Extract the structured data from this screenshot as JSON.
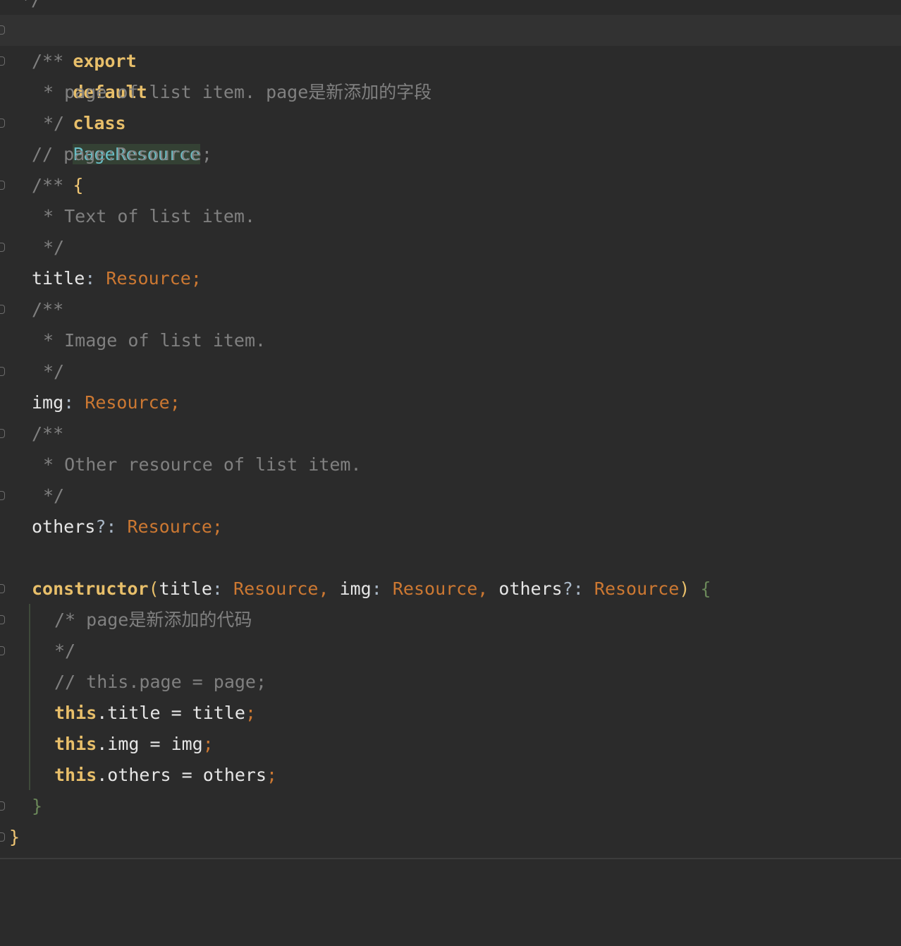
{
  "editor": {
    "lines": {
      "l0": "*/",
      "l1_kw1": "export",
      "l1_kw2": "default",
      "l1_kw3": "class",
      "l1_cls": "PageResource",
      "l1_brace": "{",
      "l2": "/**",
      "l3": "* page of list item. page是新添加的字段",
      "l4": "*/",
      "l5": "// page:Resource;",
      "l6": "/**",
      "l7": "* Text of list item.",
      "l8": "*/",
      "l9_name": "title",
      "l9_colon": ":",
      "l9_type": "Resource",
      "l9_semi": ";",
      "l10": "/**",
      "l11": "* Image of list item.",
      "l12": "*/",
      "l13_name": "img",
      "l13_colon": ":",
      "l13_type": "Resource",
      "l13_semi": ";",
      "l14": "/**",
      "l15": "* Other resource of list item.",
      "l16": "*/",
      "l17_name": "others",
      "l17_colon": "?:",
      "l17_type": "Resource",
      "l17_semi": ";",
      "l19_kw": "constructor",
      "l19_paren1": "(",
      "l19_p1": "title",
      "l19_c1": ":",
      "l19_t1": "Resource",
      "l19_comma1": ",",
      "l19_p2": "img",
      "l19_c2": ":",
      "l19_t2": "Resource",
      "l19_comma2": ",",
      "l19_p3": "others",
      "l19_c3": "?:",
      "l19_t3": "Resource",
      "l19_paren2": ")",
      "l19_brace": "{",
      "l20": "/* page是新添加的代码",
      "l21": "*/",
      "l22": "// this.page = page;",
      "l23_kw": "this",
      "l23_rest": ".title = title",
      "l23_semi": ";",
      "l24_kw": "this",
      "l24_rest": ".img = img",
      "l24_semi": ";",
      "l25_kw": "this",
      "l25_rest": ".others = others",
      "l25_semi": ";",
      "l26": "}",
      "l27": "}"
    },
    "colors": {
      "background": "#2b2b2b",
      "keyword": "#e8bf6a",
      "type": "#cc7832",
      "class_name": "#69bec7",
      "comment": "#808080"
    }
  }
}
